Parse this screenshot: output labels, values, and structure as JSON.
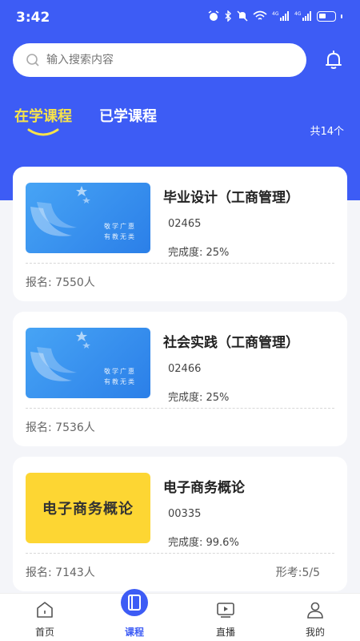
{
  "status": {
    "time": "3:42"
  },
  "search": {
    "placeholder": "输入搜索内容"
  },
  "tabs": {
    "active": "在学课程",
    "inactive": "已学课程",
    "count": "共14个"
  },
  "courses": [
    {
      "title": "毕业设计（工商管理）",
      "code": "02465",
      "progress": "完成度: 25%",
      "enroll": "报名: 7550人",
      "extra": "",
      "thumb_slogan_1": "敬学广惠",
      "thumb_slogan_2": "有教无类",
      "thumb_text": ""
    },
    {
      "title": "社会实践（工商管理）",
      "code": "02466",
      "progress": "完成度: 25%",
      "enroll": "报名: 7536人",
      "extra": "",
      "thumb_slogan_1": "敬学广惠",
      "thumb_slogan_2": "有教无类",
      "thumb_text": ""
    },
    {
      "title": "电子商务概论",
      "code": "00335",
      "progress": "完成度: 99.6%",
      "enroll": "报名: 7143人",
      "extra": "形考:5/5",
      "thumb_slogan_1": "",
      "thumb_slogan_2": "",
      "thumb_text": "电子商务概论"
    }
  ],
  "nav": {
    "home": "首页",
    "courses": "课程",
    "live": "直播",
    "mine": "我的"
  },
  "colors": {
    "primary": "#3d5cf5",
    "accent_yellow": "#f7e34a",
    "thumb_yellow": "#fdd633"
  },
  "icons": [
    "search-icon",
    "bell-icon",
    "home-icon",
    "course-book-icon",
    "live-play-icon",
    "profile-icon"
  ]
}
